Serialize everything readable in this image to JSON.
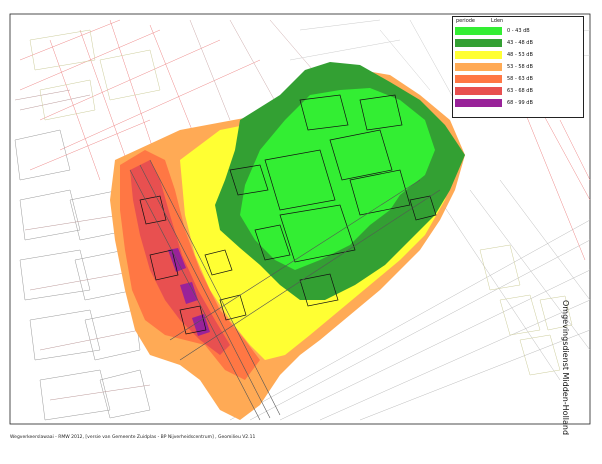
{
  "legend": {
    "col_period": "periode",
    "col_metric": "Lden",
    "items": [
      {
        "label": "0 - 43 dB",
        "color": "#33ee33"
      },
      {
        "label": "43 - 48 dB",
        "color": "#33a033"
      },
      {
        "label": "48 - 53 dB",
        "color": "#ffff33"
      },
      {
        "label": "53 - 58 dB",
        "color": "#ffaa55"
      },
      {
        "label": "58 - 63 dB",
        "color": "#ff7744"
      },
      {
        "label": "63 - 68 dB",
        "color": "#e85050"
      },
      {
        "label": "68 - 99 dB",
        "color": "#992299"
      }
    ]
  },
  "brand": "Omgevingsdienst Midden-Holland",
  "footer": "Wegverkeerslawaai - RMW 2012, [versie van Gemeente Zuidplas - BP Nijverheidscentrum] , Geomilieu V2.11"
}
